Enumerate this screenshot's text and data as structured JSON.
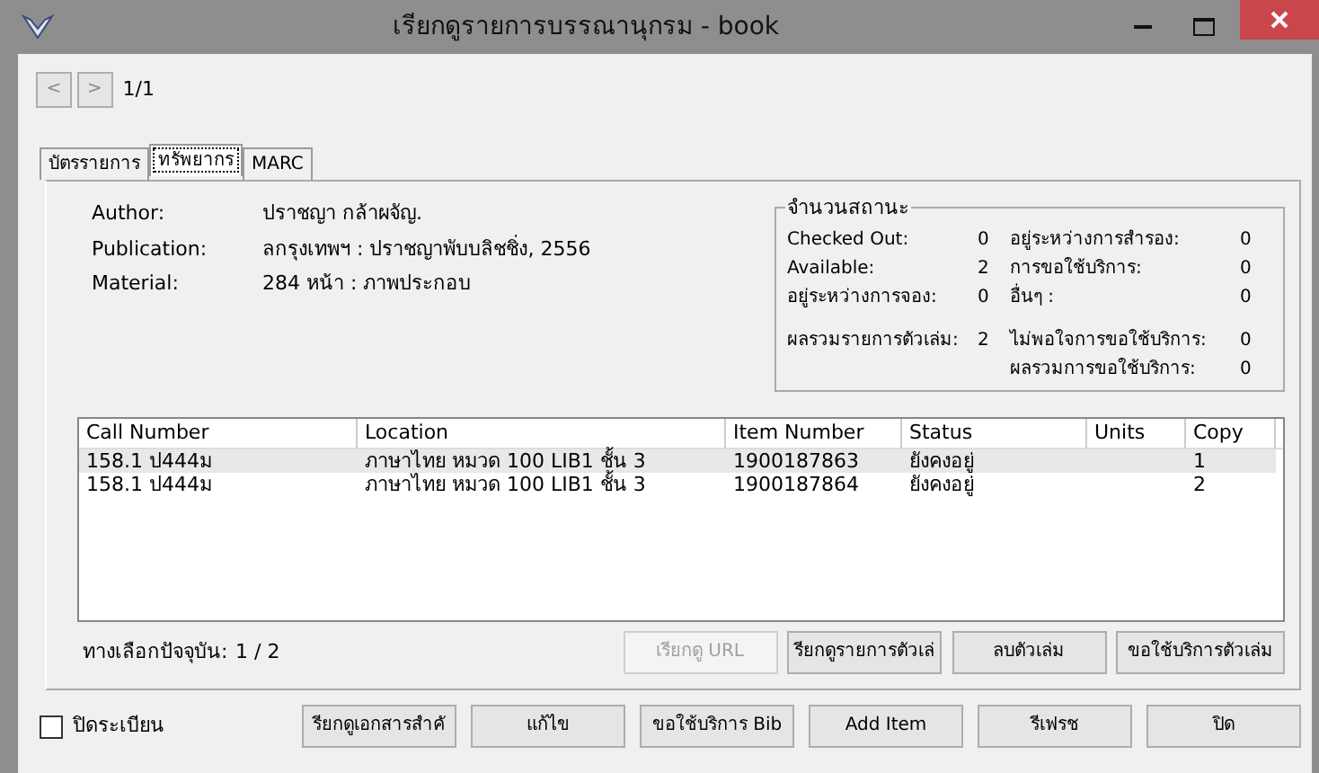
{
  "window": {
    "title": "เรียกดูรายการบรรณานุกรม - book"
  },
  "pager": {
    "prev": "<",
    "next": ">",
    "position": "1/1"
  },
  "tabs": [
    {
      "label": "บัตรรายการ",
      "selected": false
    },
    {
      "label": "ทรัพยากร",
      "selected": true
    },
    {
      "label": "MARC",
      "selected": false
    }
  ],
  "details": [
    {
      "label": "Author:",
      "value": "ปราชญา กล้าผจัญ."
    },
    {
      "label": "Publication:",
      "value": "ลกรุงเทพฯ : ปราชญาพับบลิชชิ่ง, 2556"
    },
    {
      "label": "Material:",
      "value": "284 หน้า : ภาพประกอบ"
    }
  ],
  "status_group": {
    "title": "จำนวนสถานะ",
    "rows": [
      {
        "label": "Checked Out:",
        "value": "0",
        "label_2": "อยู่ระหว่างการสำรอง:",
        "value_2": "0"
      },
      {
        "label": "Available:",
        "value": "2",
        "label_2": "การขอใช้บริการ:",
        "value_2": "0"
      },
      {
        "label": "อยู่ระหว่างการจอง:",
        "value": "0",
        "label_2": "อื่นๆ :",
        "value_2": "0"
      },
      {
        "label": "ผลรวมรายการตัวเล่ม:",
        "value": "2",
        "label_2": "ไม่พอใจการขอใช้บริการ:",
        "value_2": "0"
      },
      {
        "label_2": "ผลรวมการขอใช้บริการ:",
        "value_2": "0"
      }
    ]
  },
  "table": {
    "columns": [
      "Call Number",
      "Location",
      "Item Number",
      "Status",
      "Units",
      "Copy"
    ],
    "rows": [
      {
        "cells": [
          "158.1 ป444ม",
          "ภาษาไทย หมวด 100 LIB1 ชั้น 3",
          "1900187863",
          "ยังคงอยู่",
          "",
          "1"
        ],
        "selected": true
      },
      {
        "cells": [
          "158.1 ป444ม",
          "ภาษาไทย หมวด 100 LIB1 ชั้น 3",
          "1900187864",
          "ยังคงอยู่",
          "",
          "2"
        ],
        "selected": false
      }
    ]
  },
  "current_option": {
    "label": "ทางเลือกปัจจุบัน:",
    "value": "1 / 2"
  },
  "item_buttons": [
    {
      "label": "เรียกดู URL",
      "disabled": true
    },
    {
      "label": "รียกดูรายการตัวเล่",
      "disabled": false
    },
    {
      "label": "ลบตัวเล่ม",
      "disabled": false
    },
    {
      "label": "ขอใช้บริการตัวเล่ม",
      "disabled": false
    }
  ],
  "register_checkbox": {
    "label": "ปิดระเบียน",
    "checked": false
  },
  "buttons": [
    {
      "label": "รียกดูเอกสารสำคั",
      "disabled": false
    },
    {
      "label": "แก้ไข",
      "disabled": false
    },
    {
      "label": "ขอใช้บริการ Bib",
      "disabled": false
    },
    {
      "label": "Add Item",
      "disabled": false
    },
    {
      "label": "รีเฟรช",
      "disabled": false
    },
    {
      "label": "ปิด",
      "disabled": false
    }
  ]
}
